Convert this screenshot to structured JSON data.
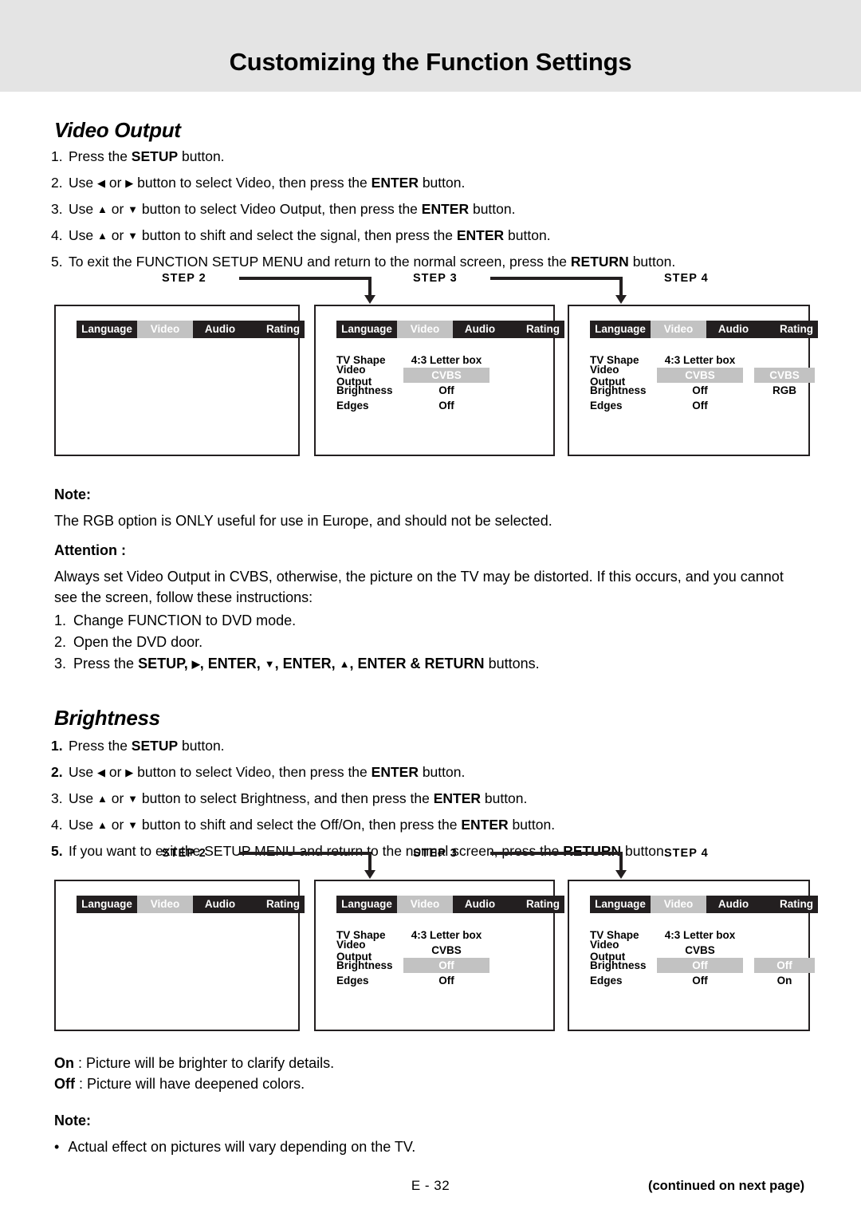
{
  "header": {
    "title": "Customizing the Function Settings"
  },
  "sections": {
    "video_output": {
      "heading": "Video Output",
      "steps": [
        {
          "num": "1.",
          "bold_num": false,
          "parts": [
            {
              "t": "Press the ",
              "b": false
            },
            {
              "t": "SETUP",
              "b": true
            },
            {
              "t": " button.",
              "b": false
            }
          ]
        },
        {
          "num": "2.",
          "bold_num": false,
          "parts": [
            {
              "t": "Use ",
              "b": false
            },
            {
              "t": "◀",
              "b": false,
              "arrow": true
            },
            {
              "t": " or ",
              "b": false
            },
            {
              "t": "▶",
              "b": false,
              "arrow": true
            },
            {
              "t": " button to select Video, then press the ",
              "b": false
            },
            {
              "t": "ENTER",
              "b": true
            },
            {
              "t": " button.",
              "b": false
            }
          ]
        },
        {
          "num": "3.",
          "bold_num": false,
          "parts": [
            {
              "t": "Use ",
              "b": false
            },
            {
              "t": "▲",
              "b": false,
              "arrow": true
            },
            {
              "t": " or ",
              "b": false
            },
            {
              "t": "▼",
              "b": false,
              "arrow": true
            },
            {
              "t": " button to select Video Output, then press the ",
              "b": false
            },
            {
              "t": "ENTER",
              "b": true
            },
            {
              "t": " button.",
              "b": false
            }
          ]
        },
        {
          "num": "4.",
          "bold_num": false,
          "parts": [
            {
              "t": "Use ",
              "b": false
            },
            {
              "t": "▲",
              "b": false,
              "arrow": true
            },
            {
              "t": " or ",
              "b": false
            },
            {
              "t": "▼",
              "b": false,
              "arrow": true
            },
            {
              "t": " button to shift and select the signal, then press the ",
              "b": false
            },
            {
              "t": "ENTER",
              "b": true
            },
            {
              "t": " button.",
              "b": false
            }
          ]
        },
        {
          "num": "5.",
          "bold_num": false,
          "parts": [
            {
              "t": "To exit the FUNCTION SETUP MENU and return to the normal screen, press the ",
              "b": false
            },
            {
              "t": "RETURN",
              "b": true
            },
            {
              "t": " button.",
              "b": false
            }
          ]
        }
      ]
    },
    "brightness": {
      "heading": "Brightness",
      "steps": [
        {
          "num": "1.",
          "bold_num": true,
          "parts": [
            {
              "t": "Press the ",
              "b": false
            },
            {
              "t": "SETUP",
              "b": true
            },
            {
              "t": " button.",
              "b": false
            }
          ]
        },
        {
          "num": "2.",
          "bold_num": true,
          "parts": [
            {
              "t": "Use ",
              "b": false
            },
            {
              "t": "◀",
              "b": false,
              "arrow": true
            },
            {
              "t": " or ",
              "b": false
            },
            {
              "t": "▶",
              "b": false,
              "arrow": true
            },
            {
              "t": " button to select Video, then press the ",
              "b": false
            },
            {
              "t": "ENTER",
              "b": true
            },
            {
              "t": " button.",
              "b": false
            }
          ]
        },
        {
          "num": "3.",
          "bold_num": false,
          "parts": [
            {
              "t": "Use ",
              "b": false
            },
            {
              "t": "▲",
              "b": false,
              "arrow": true
            },
            {
              "t": " or ",
              "b": false
            },
            {
              "t": "▼",
              "b": false,
              "arrow": true
            },
            {
              "t": " button to select Brightness, and then press the ",
              "b": false
            },
            {
              "t": "ENTER",
              "b": true
            },
            {
              "t": " button.",
              "b": false
            }
          ]
        },
        {
          "num": "4.",
          "bold_num": false,
          "parts": [
            {
              "t": "Use ",
              "b": false
            },
            {
              "t": "▲",
              "b": false,
              "arrow": true
            },
            {
              "t": " or ",
              "b": false
            },
            {
              "t": "▼",
              "b": false,
              "arrow": true
            },
            {
              "t": " button to shift and select the Off/On, then press the ",
              "b": false
            },
            {
              "t": "ENTER",
              "b": true
            },
            {
              "t": " button.",
              "b": false
            }
          ]
        },
        {
          "num": "5.",
          "bold_num": true,
          "parts": [
            {
              "t": "If you want to exit the SETUP MENU and return to the normal screen, press the ",
              "b": false
            },
            {
              "t": "RETURN",
              "b": true
            },
            {
              "t": " button.",
              "b": false
            }
          ]
        }
      ]
    }
  },
  "note_rgb": {
    "title": "Note:",
    "body": "The RGB option is ONLY useful for use in Europe, and should not be selected."
  },
  "attention": {
    "title": "Attention :",
    "body_line1": "Always set Video Output in CVBS, otherwise, the picture on the TV may be distorted. If this occurs, and you cannot",
    "body_line2": "see the screen, follow these instructions:",
    "items": [
      {
        "num": "1.",
        "parts": [
          {
            "t": "Change FUNCTION to DVD mode.",
            "b": false
          }
        ]
      },
      {
        "num": "2.",
        "parts": [
          {
            "t": "Open the DVD door.",
            "b": false
          }
        ]
      },
      {
        "num": "3.",
        "parts": [
          {
            "t": "Press the ",
            "b": false
          },
          {
            "t": "SETUP, ",
            "b": true
          },
          {
            "t": "▶",
            "b": true,
            "arrow": true
          },
          {
            "t": ", ENTER, ",
            "b": true
          },
          {
            "t": "▼",
            "b": true,
            "arrow": true
          },
          {
            "t": ", ENTER, ",
            "b": true
          },
          {
            "t": "▲",
            "b": true,
            "arrow": true
          },
          {
            "t": ", ENTER & RETURN",
            "b": true
          },
          {
            "t": " buttons.",
            "b": false
          }
        ]
      }
    ]
  },
  "onoff_desc": [
    {
      "key": "On",
      "sep": " : ",
      "text": "Picture will be brighter to clarify details."
    },
    {
      "key": "Off",
      "sep": " : ",
      "text": "Picture will have deepened colors."
    }
  ],
  "note_tv": {
    "title": "Note:",
    "bullet": "•",
    "body": "Actual effect on pictures will vary depending on the TV."
  },
  "tabs": [
    {
      "label": "Language",
      "selected": false
    },
    {
      "label": "Video",
      "selected": true
    },
    {
      "label": "Audio",
      "selected": false
    },
    {
      "label": "Rating",
      "selected": false
    }
  ],
  "diagram_video_output": {
    "step_labels": [
      "STEP  2",
      "STEP  3",
      "STEP  4"
    ],
    "panel2": {
      "rows": []
    },
    "panel3": {
      "rows": [
        {
          "label": "TV Shape",
          "value": "4:3 Letter box",
          "highlight": false,
          "sub": "",
          "sub_highlight": false
        },
        {
          "label": "Video Output",
          "value": "CVBS",
          "highlight": true,
          "sub": "",
          "sub_highlight": false
        },
        {
          "label": "Brightness",
          "value": "Off",
          "highlight": false,
          "sub": "",
          "sub_highlight": false
        },
        {
          "label": "Edges",
          "value": "Off",
          "highlight": false,
          "sub": "",
          "sub_highlight": false
        }
      ]
    },
    "panel4": {
      "rows": [
        {
          "label": "TV Shape",
          "value": "4:3 Letter box",
          "highlight": false,
          "sub": "",
          "sub_highlight": false
        },
        {
          "label": "Video Output",
          "value": "CVBS",
          "highlight": true,
          "sub": "CVBS",
          "sub_highlight": true
        },
        {
          "label": "Brightness",
          "value": "Off",
          "highlight": false,
          "sub": "RGB",
          "sub_highlight": false
        },
        {
          "label": "Edges",
          "value": "Off",
          "highlight": false,
          "sub": "",
          "sub_highlight": false
        }
      ]
    }
  },
  "diagram_brightness": {
    "step_labels": [
      "STEP  2",
      "STEP  3",
      "STEP  4"
    ],
    "panel2": {
      "rows": []
    },
    "panel3": {
      "rows": [
        {
          "label": "TV Shape",
          "value": "4:3 Letter box",
          "highlight": false,
          "sub": "",
          "sub_highlight": false
        },
        {
          "label": "Video Output",
          "value": "CVBS",
          "highlight": false,
          "sub": "",
          "sub_highlight": false
        },
        {
          "label": "Brightness",
          "value": "Off",
          "highlight": true,
          "sub": "",
          "sub_highlight": false
        },
        {
          "label": "Edges",
          "value": "Off",
          "highlight": false,
          "sub": "",
          "sub_highlight": false
        }
      ]
    },
    "panel4": {
      "rows": [
        {
          "label": "TV Shape",
          "value": "4:3 Letter box",
          "highlight": false,
          "sub": "",
          "sub_highlight": false
        },
        {
          "label": "Video Output",
          "value": "CVBS",
          "highlight": false,
          "sub": "",
          "sub_highlight": false
        },
        {
          "label": "Brightness",
          "value": "Off",
          "highlight": true,
          "sub": "Off",
          "sub_highlight": true
        },
        {
          "label": "Edges",
          "value": "Off",
          "highlight": false,
          "sub": "On",
          "sub_highlight": false
        }
      ]
    }
  },
  "footer": {
    "page_number": "E  -  32",
    "continued": "(continued on next page)"
  },
  "colors": {
    "header_band": "#e4e4e4",
    "menu_bar": "#231f20",
    "highlight": "#c2c2c2",
    "highlight_text": "#ffffff"
  }
}
